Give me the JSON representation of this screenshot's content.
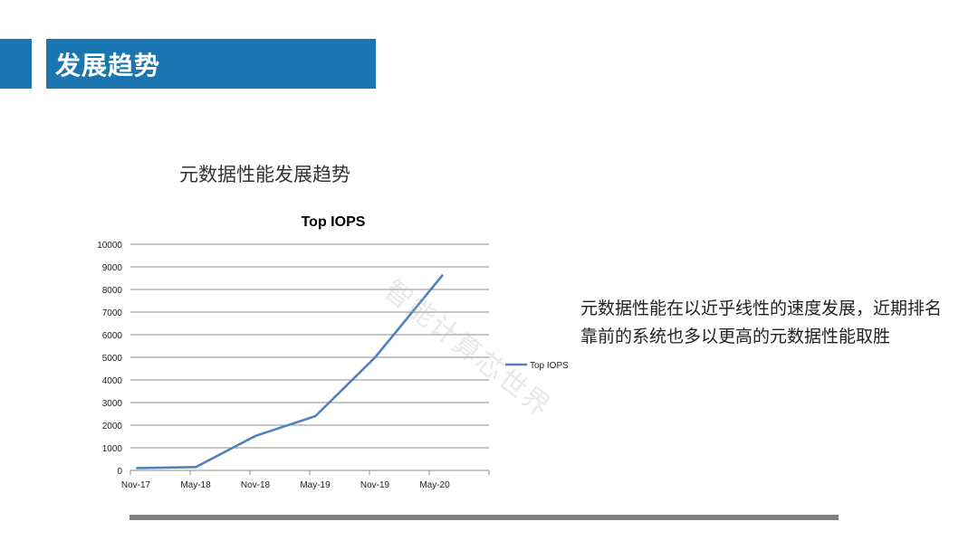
{
  "header": {
    "title": "发展趋势"
  },
  "subtitle": "元数据性能发展趋势",
  "description": "元数据性能在以近乎线性的速度发展，近期排名靠前的系统也多以更高的元数据性能取胜",
  "watermark": "智能计算芯世界",
  "colors": {
    "accent": "#1b75b0",
    "series": "#4f81bd",
    "divider": "#7f7f7f"
  },
  "chart_data": {
    "type": "line",
    "title": "Top IOPS",
    "xlabel": "",
    "ylabel": "",
    "categories": [
      "Nov-17",
      "May-18",
      "Nov-18",
      "May-19",
      "Nov-19",
      "May-20"
    ],
    "x": [
      "Nov-17",
      "May-18",
      "Nov-18",
      "May-19",
      "Nov-19",
      "May-20"
    ],
    "series": [
      {
        "name": "Top IOPS",
        "values": [
          100,
          150,
          1530,
          2400,
          5000,
          8650
        ]
      }
    ],
    "ylim": [
      0,
      10000
    ],
    "yticks": [
      0,
      1000,
      2000,
      3000,
      4000,
      5000,
      6000,
      7000,
      8000,
      9000,
      10000
    ],
    "grid": true,
    "legend": "right"
  }
}
